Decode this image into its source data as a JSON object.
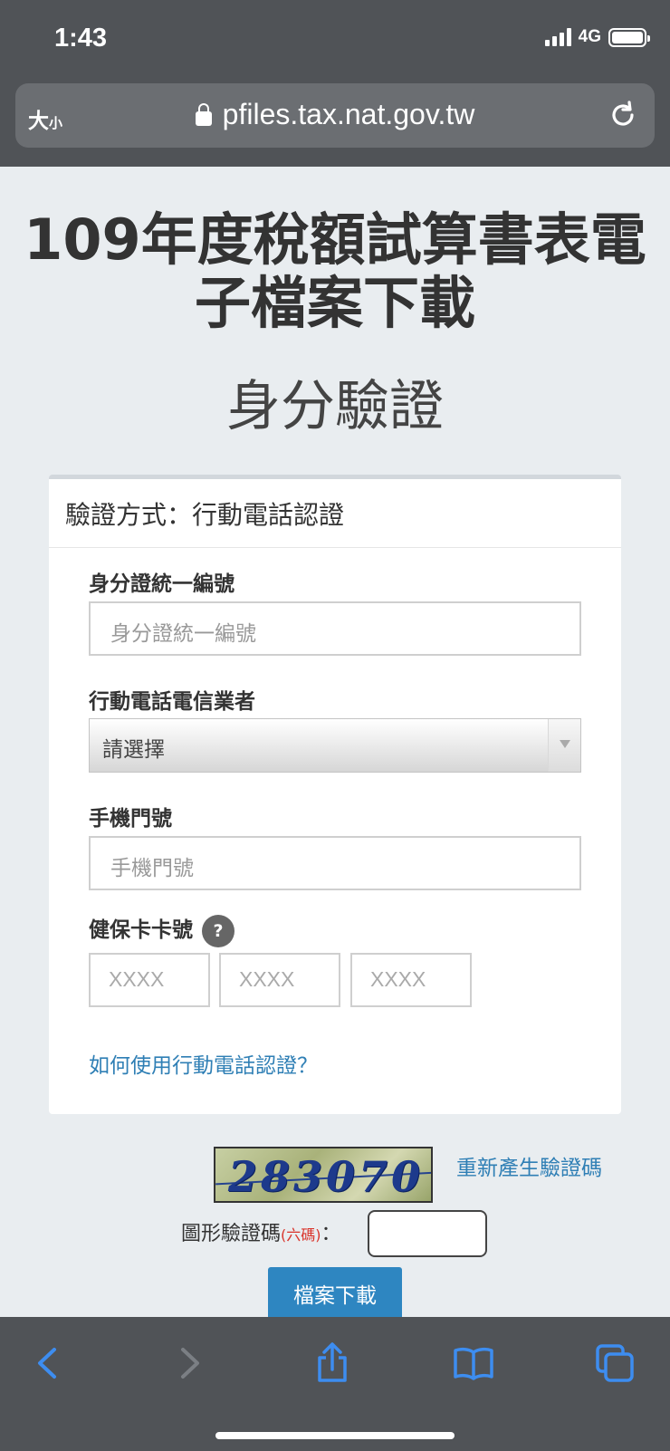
{
  "status": {
    "time": "1:43",
    "network": "4G"
  },
  "browser": {
    "text_size_big": "大",
    "text_size_small": "小",
    "url": "pfiles.tax.nat.gov.tw"
  },
  "page": {
    "title": "109年度稅額試算書表電子檔案下載",
    "subtitle": "身分驗證"
  },
  "form": {
    "heading": "驗證方式：行動電話認證",
    "id_label": "身分證統一編號",
    "id_placeholder": "身分證統一編號",
    "carrier_label": "行動電話電信業者",
    "carrier_value": "請選擇",
    "phone_label": "手機門號",
    "phone_placeholder": "手機門號",
    "card_label": "健保卡卡號",
    "help_symbol": "?",
    "card_placeholders": [
      "XXXX",
      "XXXX",
      "XXXX"
    ],
    "howto_link": "如何使用行動電話認證？"
  },
  "captcha": {
    "code": "283070",
    "regenerate_link": "重新產生驗證碼",
    "label": "圖形驗證碼",
    "label_note": "(六碼)",
    "label_colon": "："
  },
  "download_button": "檔案下載",
  "colors": {
    "link": "#2f7fb5",
    "button": "#2e86c1",
    "chrome": "#505357",
    "icon": "#3d8df0"
  },
  "toolbar_icons": [
    "back-icon",
    "forward-icon",
    "share-icon",
    "bookmarks-icon",
    "tabs-icon"
  ]
}
